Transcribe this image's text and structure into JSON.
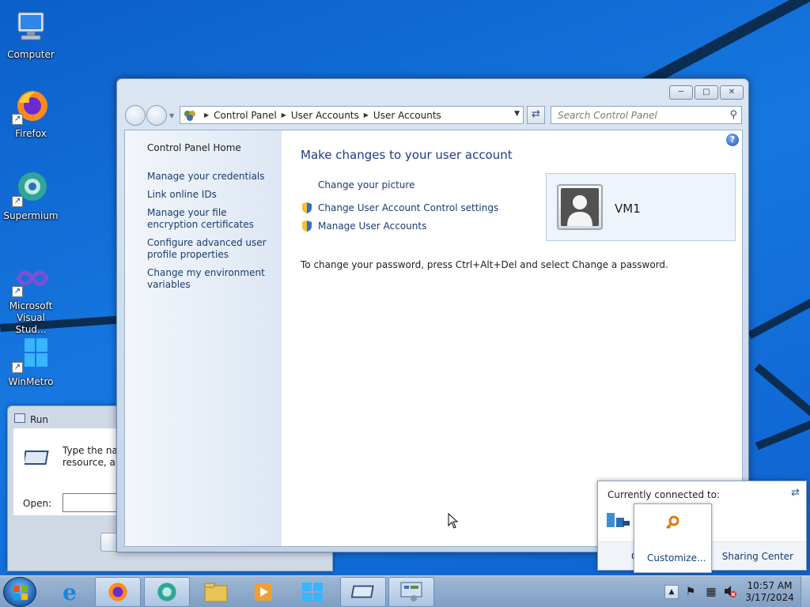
{
  "desktop": {
    "icons": [
      {
        "label": "Computer",
        "icon": "computer-icon"
      },
      {
        "label": "Firefox",
        "icon": "firefox-icon"
      },
      {
        "label": "Supermium",
        "icon": "supermium-icon"
      },
      {
        "label": "Microsoft Visual Stud...",
        "icon": "visual-studio-icon"
      },
      {
        "label": "WinMetro",
        "icon": "winmetro-icon"
      }
    ]
  },
  "run_dialog": {
    "title": "Run",
    "description": "Type the nan\nresource, and",
    "open_label": "Open:"
  },
  "window": {
    "breadcrumb": [
      "Control Panel",
      "User Accounts",
      "User Accounts"
    ],
    "search_placeholder": "Search Control Panel",
    "left_nav": {
      "home": "Control Panel Home",
      "links": [
        "Manage your credentials",
        "Link online IDs",
        "Manage your file encryption certificates",
        "Configure advanced user profile properties",
        "Change my environment variables"
      ]
    },
    "main": {
      "title": "Make changes to your user account",
      "tasks": [
        {
          "label": "Change your picture",
          "shield": false
        },
        {
          "label": "Change User Account Control settings",
          "shield": true
        },
        {
          "label": "Manage User Accounts",
          "shield": true
        }
      ],
      "password_note": "To change your password, press Ctrl+Alt+Del and select Change a password.",
      "user_name": "VM1"
    }
  },
  "network_popup": {
    "header": "Currently connected to:",
    "partial_left": "C",
    "sharing_center": "Sharing Center",
    "customize": "Customize..."
  },
  "taskbar": {
    "time": "10:57 AM",
    "date": "3/17/2024",
    "pinned": [
      "internet-explorer-icon",
      "firefox-icon",
      "supermium-icon",
      "file-explorer-icon",
      "media-player-icon",
      "winmetro-icon",
      "run-icon",
      "control-panel-icon"
    ]
  },
  "colors": {
    "wallpaper": "#1677e0",
    "link": "#1a3b6e",
    "title": "#1e3a8a"
  }
}
